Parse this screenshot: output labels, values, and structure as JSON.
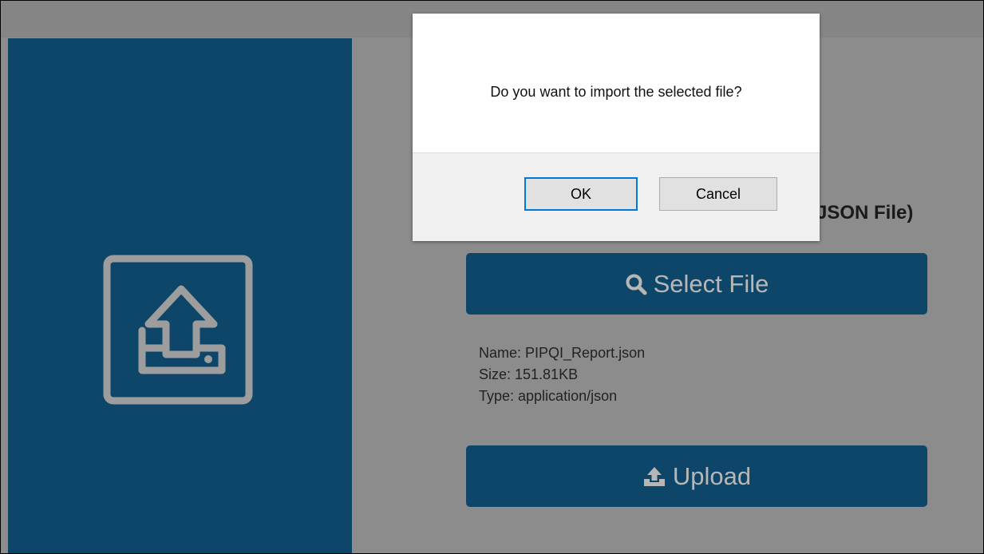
{
  "page": {
    "heading_visible_tail": "JSON File)"
  },
  "side_panel": {
    "icon": "inbox-upload-icon"
  },
  "select_button": {
    "icon": "search-icon",
    "label": "Select File"
  },
  "file": {
    "name_line": "Name: PIPQI_Report.json",
    "size_line": "Size: 151.81KB",
    "type_line": "Type: application/json"
  },
  "upload_button": {
    "icon": "upload-icon",
    "label": "Upload"
  },
  "dialog": {
    "message": "Do you want to import the selected file?",
    "ok_label": "OK",
    "cancel_label": "Cancel"
  },
  "colors": {
    "panel": "#0e466a",
    "overlay": "#8c8c8c",
    "button_text": "#b7b7b7",
    "focus": "#0078d7"
  }
}
